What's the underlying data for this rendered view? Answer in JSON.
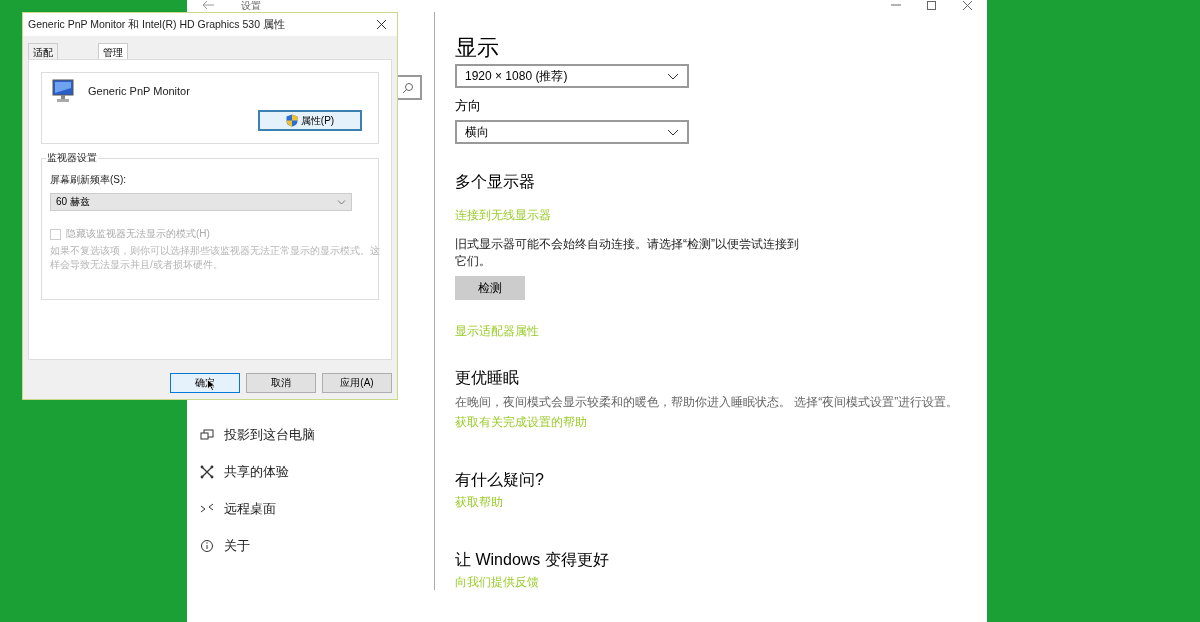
{
  "settings_window": {
    "title": "设置",
    "nav_items": [
      {
        "label": "投影到这台电脑"
      },
      {
        "label": "共享的体验"
      },
      {
        "label": "远程桌面"
      },
      {
        "label": "关于"
      }
    ],
    "content": [
      {
        "kind": "title",
        "text": "显示"
      },
      {
        "kind": "dropdown",
        "text": "1920 × 1080 (推荐)"
      },
      {
        "kind": "label",
        "text": "方向"
      },
      {
        "kind": "dropdown",
        "text": "横向"
      },
      {
        "kind": "heading",
        "text": "多个显示器"
      },
      {
        "kind": "link",
        "text": "连接到无线显示器"
      },
      {
        "kind": "paragraph",
        "text": "旧式显示器可能不会始终自动连接。请选择“检测”以便尝试连接到它们。"
      },
      {
        "kind": "button",
        "text": "检测"
      },
      {
        "kind": "link",
        "text": "显示适配器属性"
      },
      {
        "kind": "heading",
        "text": "更优睡眠"
      },
      {
        "kind": "note",
        "text": "在晚间，夜间模式会显示较柔和的暖色，帮助你进入睡眠状态。 选择“夜间模式设置”进行设置。"
      },
      {
        "kind": "link",
        "text": "获取有关完成设置的帮助"
      },
      {
        "kind": "heading",
        "text": "有什么疑问?"
      },
      {
        "kind": "link",
        "text": "获取帮助"
      },
      {
        "kind": "heading",
        "text": "让 Windows 变得更好"
      },
      {
        "kind": "link",
        "text": "向我们提供反馈"
      }
    ]
  },
  "dialog": {
    "title": "Generic PnP Monitor 和 Intel(R) HD Graphics 530 属性",
    "tabs": [
      {
        "label": "适配",
        "selected": false
      },
      {
        "label": "管理",
        "selected": true
      }
    ],
    "monitor_type": {
      "device": "Generic PnP Monitor",
      "properties_button": {
        "label": "属性(P)",
        "highlighted": true
      }
    },
    "monitor_settings": {
      "title": "监视器设置",
      "refresh_label": "屏幕刷新频率(S):",
      "refresh_value": "60 赫兹",
      "hide_modes": {
        "label": "隐藏该监视器无法显示的模式(H)",
        "checked": false,
        "disabled": true
      },
      "note": "如果不复选该项，则你可以选择那些该监视器无法正常显示的显示模式。这样会导致无法显示并且/或者损坏硬件。"
    },
    "buttons": [
      {
        "label": "确定",
        "default": true
      },
      {
        "label": "取消",
        "default": false
      },
      {
        "label": "应用(A)",
        "default": false
      }
    ]
  }
}
